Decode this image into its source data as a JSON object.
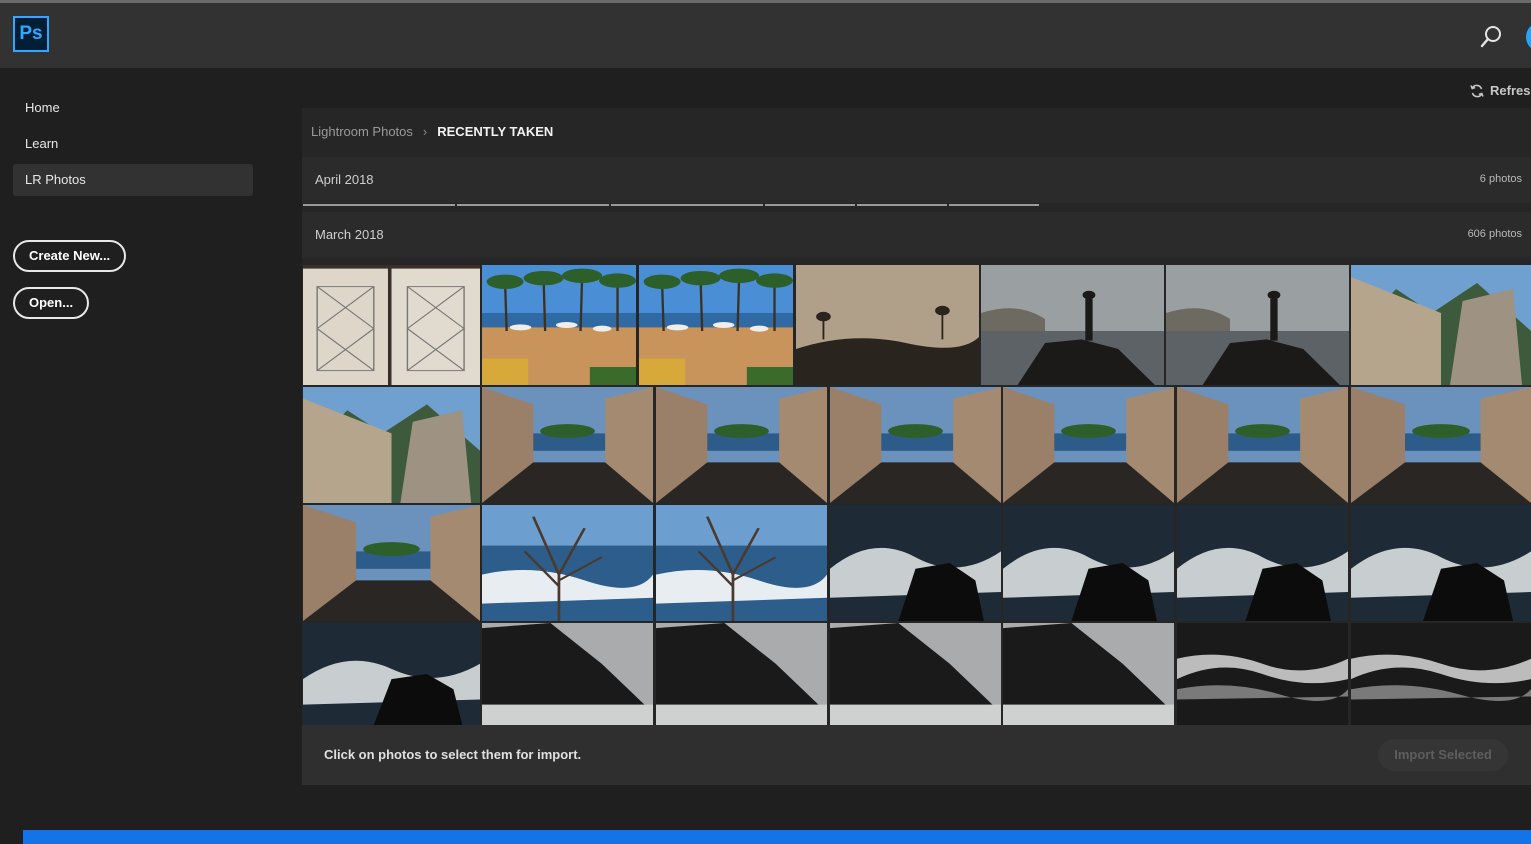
{
  "app": {
    "logo_text": "Ps",
    "brand_color": "#31a8ff"
  },
  "header": {
    "search_icon": "search-icon"
  },
  "sidebar": {
    "items": [
      {
        "label": "Home"
      },
      {
        "label": "Learn"
      },
      {
        "label": "LR Photos",
        "active": true
      }
    ],
    "create_label": "Create New...",
    "open_label": "Open..."
  },
  "toolbar": {
    "refresh_label": "Refresh"
  },
  "breadcrumb": {
    "parent": "Lightroom Photos",
    "current": "RECENTLY TAKEN"
  },
  "groups": [
    {
      "label": "April 2018",
      "count": "6 photos"
    },
    {
      "label": "March 2018",
      "count": "606 photos"
    }
  ],
  "photos": [
    {
      "subject": "sketch-pages"
    },
    {
      "subject": "palm-terrace"
    },
    {
      "subject": "palm-terrace"
    },
    {
      "subject": "hazy-silhouette"
    },
    {
      "subject": "figure-on-rocks"
    },
    {
      "subject": "figure-on-rocks"
    },
    {
      "subject": "stone-wall-mountain"
    },
    {
      "subject": "stone-wall-mountain"
    },
    {
      "subject": "wall-path-sea"
    },
    {
      "subject": "wall-path-sea"
    },
    {
      "subject": "wall-path-sea"
    },
    {
      "subject": "wall-path-sea"
    },
    {
      "subject": "wall-path-sea"
    },
    {
      "subject": "wall-path-sea"
    },
    {
      "subject": "wall-path-sea"
    },
    {
      "subject": "branches-waves"
    },
    {
      "subject": "branches-waves"
    },
    {
      "subject": "dark-surf"
    },
    {
      "subject": "dark-surf"
    },
    {
      "subject": "dark-surf"
    },
    {
      "subject": "dark-surf"
    },
    {
      "subject": "dark-surf"
    },
    {
      "subject": "cliff-backlit"
    },
    {
      "subject": "cliff-backlit"
    },
    {
      "subject": "cliff-backlit"
    },
    {
      "subject": "cliff-backlit"
    },
    {
      "subject": "glittering-sea"
    },
    {
      "subject": "glittering-sea"
    }
  ],
  "footer": {
    "hint": "Click on photos to select them for import.",
    "import_label": "Import Selected"
  }
}
